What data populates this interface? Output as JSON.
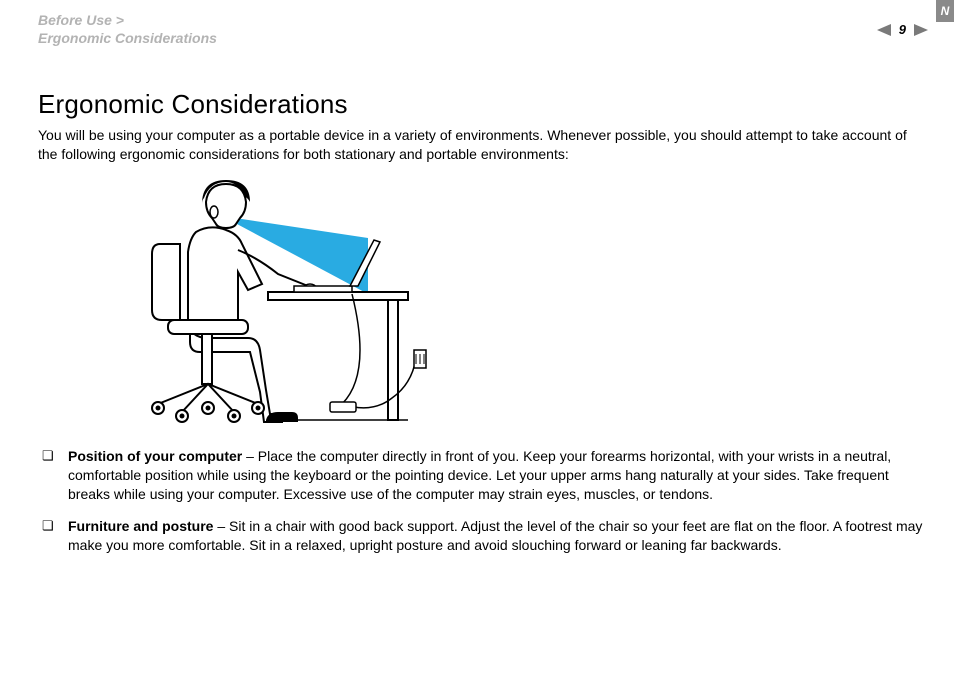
{
  "header": {
    "breadcrumb_line1": "Before Use >",
    "breadcrumb_line2": "Ergonomic Considerations",
    "page_number": "9",
    "flag_letter": "N"
  },
  "content": {
    "title": "Ergonomic Considerations",
    "intro": "You will be using your computer as a portable device in a variety of environments. Whenever possible, you should attempt to take account of the following ergonomic considerations for both stationary and portable environments:",
    "bullets": [
      {
        "bold": "Position of your computer",
        "text": " – Place the computer directly in front of you. Keep your forearms horizontal, with your wrists in a neutral, comfortable position while using the keyboard or the pointing device. Let your upper arms hang naturally at your sides. Take frequent breaks while using your computer. Excessive use of the computer may strain eyes, muscles, or tendons."
      },
      {
        "bold": "Furniture and posture",
        "text": " – Sit in a chair with good back support. Adjust the level of the chair so your feet are flat on the floor. A footrest may make you more comfortable. Sit in a relaxed, upright posture and avoid slouching forward or leaning far backwards."
      }
    ]
  }
}
